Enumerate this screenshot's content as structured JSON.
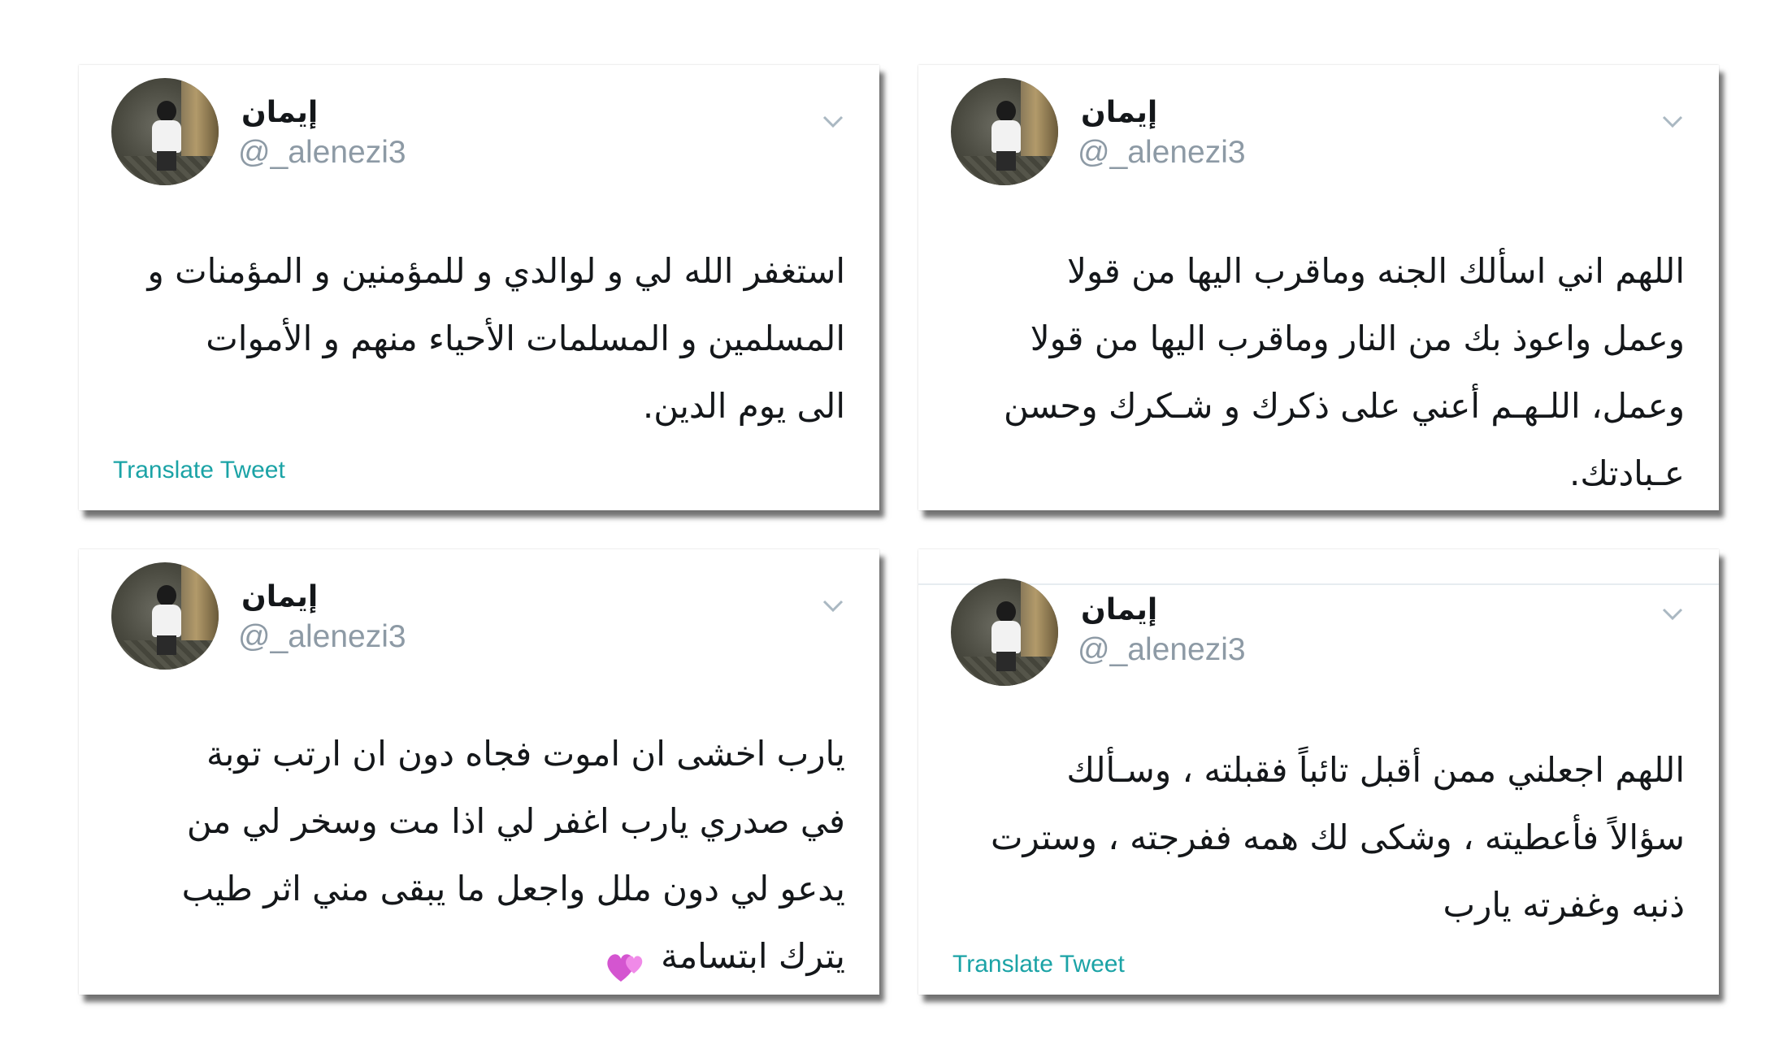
{
  "tweets": [
    {
      "author_name": "إيمان",
      "author_handle": "@_alenezi3",
      "avatar_icon": "profile-photo",
      "menu_icon": "chevron-down-icon",
      "lines": [
        "استغفر الله لي و لوالدي و للمؤمنين و المؤمنات و",
        "المسلمين و المسلمات الأحياء منهم و الأموات",
        "الى يوم الدين."
      ],
      "translate_label": "Translate Tweet"
    },
    {
      "author_name": "إيمان",
      "author_handle": "@_alenezi3",
      "avatar_icon": "profile-photo",
      "menu_icon": "chevron-down-icon",
      "lines": [
        "اللهم اني اسألك الجنه وماقرب اليها من قولا",
        "وعمل واعوذ بك من النار وماقرب اليها من قولا",
        "وعمل، اللـهـم أعني على ذكرك و شـكرك وحسن",
        "عـبادتك."
      ]
    },
    {
      "author_name": "إيمان",
      "author_handle": "@_alenezi3",
      "avatar_icon": "profile-photo",
      "menu_icon": "chevron-down-icon",
      "lines": [
        "يارب اخشى ان اموت فجاه دون ان ارتب توبة",
        "في صدري يارب اغفر لي اذا مت وسخر لي من",
        "يدعو لي دون ملل واجعل ما يبقى مني اثر طيب",
        "يترك ابتسامة"
      ],
      "emoji": "two-hearts-icon"
    },
    {
      "author_name": "إيمان",
      "author_handle": "@_alenezi3",
      "avatar_icon": "profile-photo",
      "menu_icon": "chevron-down-icon",
      "lines": [
        "اللهم اجعلني ممن أقبل تائباً فقبلته ، وسـألك",
        "سؤالاً فأعطيته ، وشكى لك همه ففرجته ، وسترت",
        "ذنبه وغفرته يارب"
      ],
      "translate_label": "Translate Tweet"
    }
  ],
  "colors": {
    "text": "#14171a",
    "handle": "#8d9aa5",
    "translate_link": "#1ba3a6",
    "chevron": "#aab8c2",
    "hearts": "#e05fd8"
  }
}
